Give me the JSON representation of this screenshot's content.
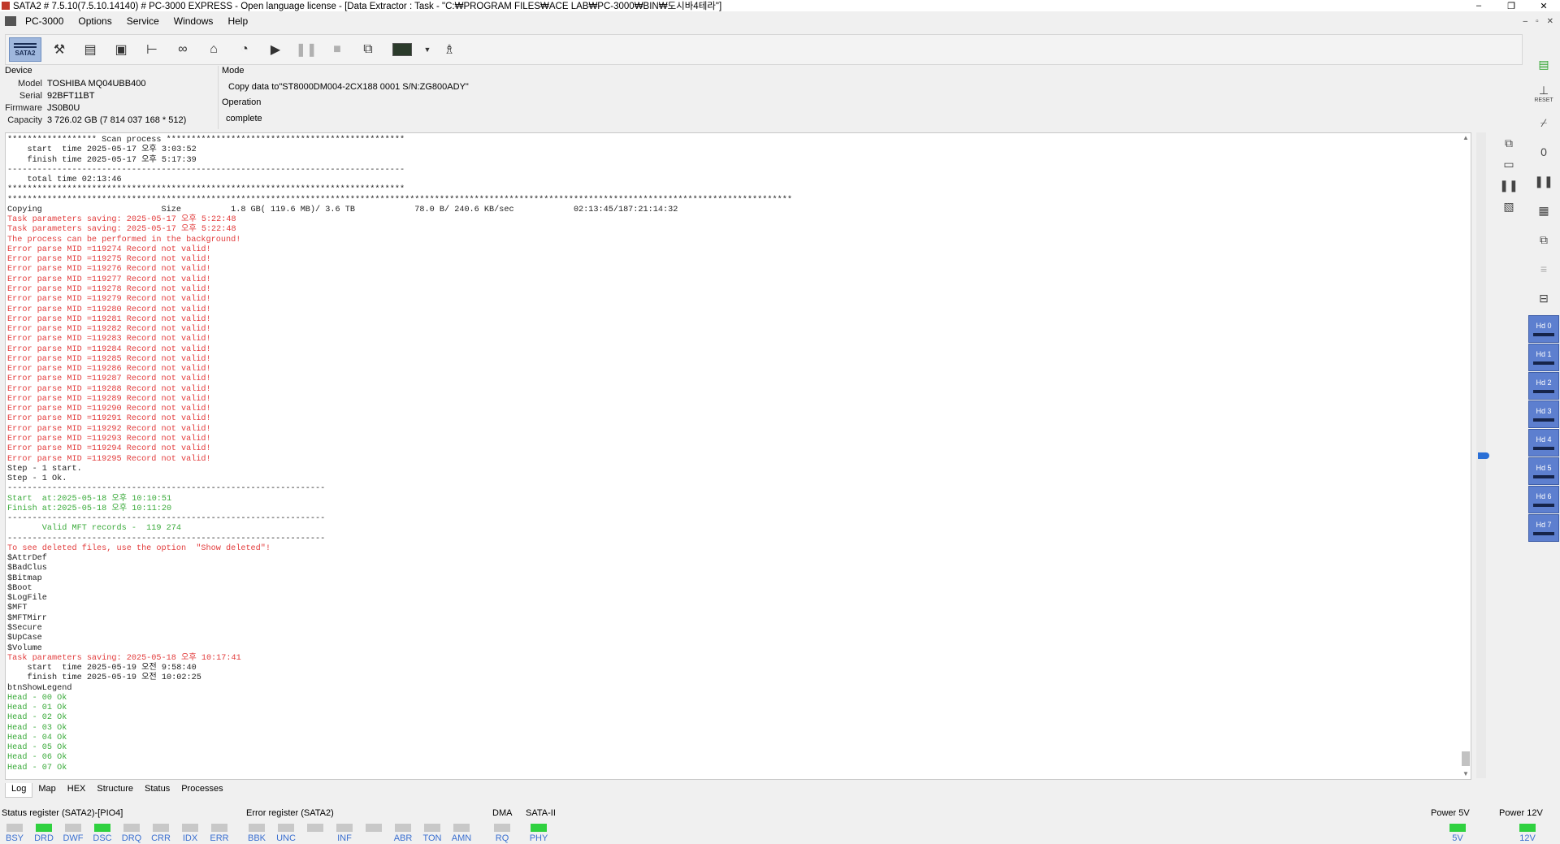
{
  "window": {
    "title": "SATA2 # 7.5.10(7.5.10.14140) # PC-3000 EXPRESS - Open language license - [Data Extractor : Task - \"C:₩PROGRAM FILES₩ACE LAB₩PC-3000₩BIN₩도시바4테라\"]",
    "controls": [
      "–",
      "❐",
      "✕"
    ]
  },
  "menu": {
    "items": [
      "PC-3000",
      "Options",
      "Service",
      "Windows",
      "Help"
    ],
    "mdi_controls": [
      "–",
      "▫",
      "✕"
    ]
  },
  "toolbar": {
    "sata_label": "SATA2",
    "icons": [
      "tools-icon",
      "drive-info-icon",
      "percent-icon",
      "tree-icon",
      "binoculars-icon",
      "hdd-icon",
      "disk-icon",
      "play-icon",
      "pause-icon",
      "stop-icon",
      "copy-icon",
      "monitor-icon",
      "dropdown-icon",
      "person-icon"
    ]
  },
  "device": {
    "header": "Device",
    "model_label": "Model",
    "model": "TOSHIBA MQ04UBB400",
    "serial_label": "Serial",
    "serial": "92BFT11BT",
    "firmware_label": "Firmware",
    "firmware": "JS0B0U",
    "capacity_label": "Capacity",
    "capacity": "3 726.02 GB (7 814 037 168 * 512)"
  },
  "mode": {
    "header": "Mode",
    "value": "Copy data to\"ST8000DM004-2CX188 0001 S/N:ZG800ADY\"",
    "operation_header": "Operation",
    "operation_value": "complete"
  },
  "log": {
    "lines": [
      {
        "c": "dark",
        "t": "****************** Scan process ************************************************"
      },
      {
        "c": "dark",
        "t": "    start  time 2025-05-17 오후 3:03:52"
      },
      {
        "c": "dark",
        "t": "    finish time 2025-05-17 오후 5:17:39"
      },
      {
        "c": "dark",
        "t": "--------------------------------------------------------------------------------"
      },
      {
        "c": "dark",
        "t": "    total time 02:13:46"
      },
      {
        "c": "dark",
        "t": "********************************************************************************"
      },
      {
        "c": "dark",
        "t": "**************************************************************************************************************************************************************"
      },
      {
        "c": "dark",
        "t": "Copying                        Size          1.8 GB( 119.6 MB)/ 3.6 TB            78.0 B/ 240.6 KB/sec            02:13:45/187:21:14:32"
      },
      {
        "c": "red",
        "t": "Task parameters saving: 2025-05-17 오후 5:22:48"
      },
      {
        "c": "red",
        "t": "Task parameters saving: 2025-05-17 오후 5:22:48"
      },
      {
        "c": "red",
        "t": "The process can be performed in the background!"
      },
      {
        "c": "red",
        "t": "Error parse MID =119274 Record not valid!"
      },
      {
        "c": "red",
        "t": "Error parse MID =119275 Record not valid!"
      },
      {
        "c": "red",
        "t": "Error parse MID =119276 Record not valid!"
      },
      {
        "c": "red",
        "t": "Error parse MID =119277 Record not valid!"
      },
      {
        "c": "red",
        "t": "Error parse MID =119278 Record not valid!"
      },
      {
        "c": "red",
        "t": "Error parse MID =119279 Record not valid!"
      },
      {
        "c": "red",
        "t": "Error parse MID =119280 Record not valid!"
      },
      {
        "c": "red",
        "t": "Error parse MID =119281 Record not valid!"
      },
      {
        "c": "red",
        "t": "Error parse MID =119282 Record not valid!"
      },
      {
        "c": "red",
        "t": "Error parse MID =119283 Record not valid!"
      },
      {
        "c": "red",
        "t": "Error parse MID =119284 Record not valid!"
      },
      {
        "c": "red",
        "t": "Error parse MID =119285 Record not valid!"
      },
      {
        "c": "red",
        "t": "Error parse MID =119286 Record not valid!"
      },
      {
        "c": "red",
        "t": "Error parse MID =119287 Record not valid!"
      },
      {
        "c": "red",
        "t": "Error parse MID =119288 Record not valid!"
      },
      {
        "c": "red",
        "t": "Error parse MID =119289 Record not valid!"
      },
      {
        "c": "red",
        "t": "Error parse MID =119290 Record not valid!"
      },
      {
        "c": "red",
        "t": "Error parse MID =119291 Record not valid!"
      },
      {
        "c": "red",
        "t": "Error parse MID =119292 Record not valid!"
      },
      {
        "c": "red",
        "t": "Error parse MID =119293 Record not valid!"
      },
      {
        "c": "red",
        "t": "Error parse MID =119294 Record not valid!"
      },
      {
        "c": "red",
        "t": "Error parse MID =119295 Record not valid!"
      },
      {
        "c": "dark",
        "t": "Step - 1 start."
      },
      {
        "c": "dark",
        "t": "Step - 1 Ok."
      },
      {
        "c": "dark",
        "t": "----------------------------------------------------------------"
      },
      {
        "c": "green",
        "t": "Start  at:2025-05-18 오후 10:10:51"
      },
      {
        "c": "green",
        "t": "Finish at:2025-05-18 오후 10:11:20"
      },
      {
        "c": "dark",
        "t": "----------------------------------------------------------------"
      },
      {
        "c": "green",
        "t": "       Valid MFT records -  119 274"
      },
      {
        "c": "dark",
        "t": "----------------------------------------------------------------"
      },
      {
        "c": "red",
        "t": "To see deleted files, use the option  \"Show deleted\"!"
      },
      {
        "c": "dark",
        "t": "$AttrDef"
      },
      {
        "c": "dark",
        "t": "$BadClus"
      },
      {
        "c": "dark",
        "t": "$Bitmap"
      },
      {
        "c": "dark",
        "t": "$Boot"
      },
      {
        "c": "dark",
        "t": "$LogFile"
      },
      {
        "c": "dark",
        "t": "$MFT"
      },
      {
        "c": "dark",
        "t": "$MFTMirr"
      },
      {
        "c": "dark",
        "t": "$Secure"
      },
      {
        "c": "dark",
        "t": "$UpCase"
      },
      {
        "c": "dark",
        "t": "$Volume"
      },
      {
        "c": "red",
        "t": "Task parameters saving: 2025-05-18 오후 10:17:41"
      },
      {
        "c": "dark",
        "t": "    start  time 2025-05-19 오전 9:58:40"
      },
      {
        "c": "dark",
        "t": "    finish time 2025-05-19 오전 10:02:25"
      },
      {
        "c": "dark",
        "t": "btnShowLegend"
      },
      {
        "c": "green",
        "t": "Head - 00 Ok"
      },
      {
        "c": "green",
        "t": "Head - 01 Ok"
      },
      {
        "c": "green",
        "t": "Head - 02 Ok"
      },
      {
        "c": "green",
        "t": "Head - 03 Ok"
      },
      {
        "c": "green",
        "t": "Head - 04 Ok"
      },
      {
        "c": "green",
        "t": "Head - 05 Ok"
      },
      {
        "c": "green",
        "t": "Head - 06 Ok"
      },
      {
        "c": "green",
        "t": "Head - 07 Ok"
      }
    ]
  },
  "right_tools": [
    "window-icon",
    "save-icon",
    "pause-icon",
    "drive-image-icon"
  ],
  "rightbar": {
    "reset_label": "RESET",
    "power_label": "0",
    "heads": [
      "Hd 0",
      "Hd 1",
      "Hd 2",
      "Hd 3",
      "Hd 4",
      "Hd 5",
      "Hd 6",
      "Hd 7"
    ]
  },
  "tabs": [
    "Log",
    "Map",
    "HEX",
    "Structure",
    "Status",
    "Processes"
  ],
  "status": {
    "status_register_label": "Status register (SATA2)-[PIO4]",
    "status_leds": [
      {
        "label": "BSY",
        "on": false
      },
      {
        "label": "DRD",
        "on": true
      },
      {
        "label": "DWF",
        "on": false
      },
      {
        "label": "DSC",
        "on": true
      },
      {
        "label": "DRQ",
        "on": false
      },
      {
        "label": "CRR",
        "on": false
      },
      {
        "label": "IDX",
        "on": false
      },
      {
        "label": "ERR",
        "on": false
      }
    ],
    "error_register_label": "Error register (SATA2)",
    "error_leds": [
      {
        "label": "BBK",
        "on": false
      },
      {
        "label": "UNC",
        "on": false
      },
      {
        "label": "",
        "on": false
      },
      {
        "label": "INF",
        "on": false
      },
      {
        "label": "",
        "on": false
      },
      {
        "label": "ABR",
        "on": false
      },
      {
        "label": "TON",
        "on": false
      },
      {
        "label": "AMN",
        "on": false
      }
    ],
    "dma_label": "DMA",
    "dma_led": {
      "label": "RQ",
      "on": false
    },
    "sata_label": "SATA-II",
    "sata_led": {
      "label": "PHY",
      "on": true
    },
    "power5_label": "Power 5V",
    "power5_led": {
      "label": "5V",
      "on": true
    },
    "power12_label": "Power 12V",
    "power12_led": {
      "label": "12V",
      "on": true
    }
  }
}
